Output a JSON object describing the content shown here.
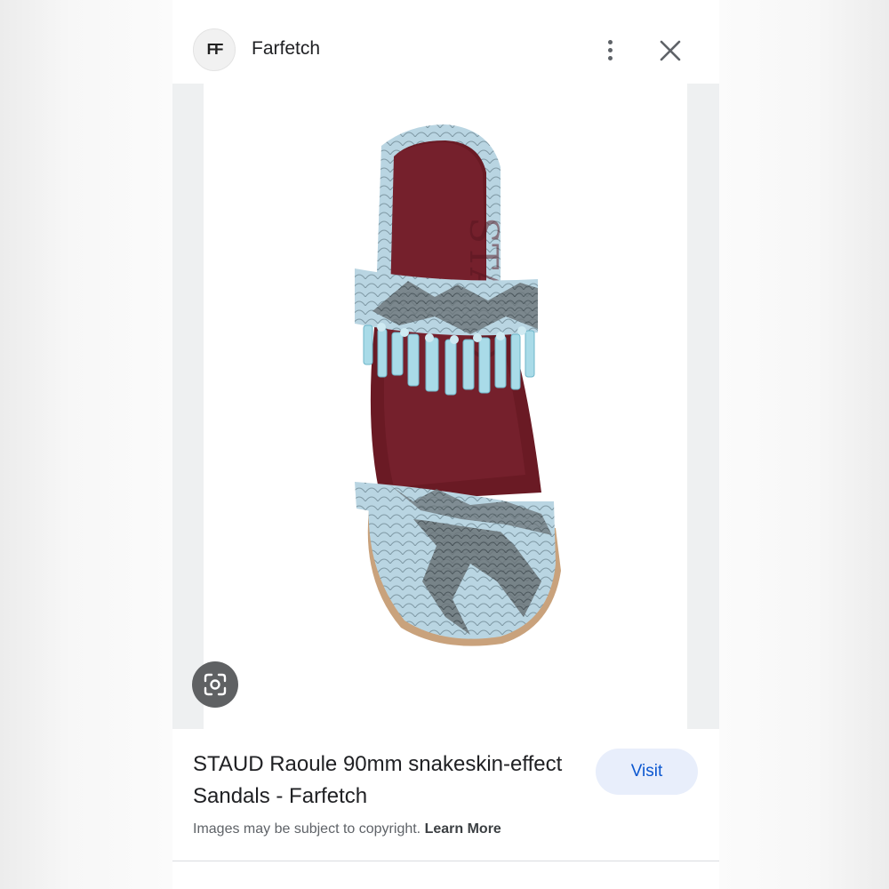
{
  "header": {
    "site_icon": "farfetch-logo-icon",
    "site_icon_text": "FF",
    "site_name": "Farfetch",
    "more_icon": "more-vertical-icon",
    "close_icon": "close-icon"
  },
  "image": {
    "lens_icon": "lens-search-icon"
  },
  "result": {
    "title": "STAUD Raoule 90mm snakeskin-effect Sandals - Farfetch",
    "visit_label": "Visit",
    "copyright_text": "Images may be subject to copyright.",
    "learn_more_label": "Learn More"
  },
  "colors": {
    "visit_bg": "#e8eefb",
    "visit_text": "#0b57d0",
    "lens_bg": "#5f6163",
    "insole": "#6a1a24"
  }
}
